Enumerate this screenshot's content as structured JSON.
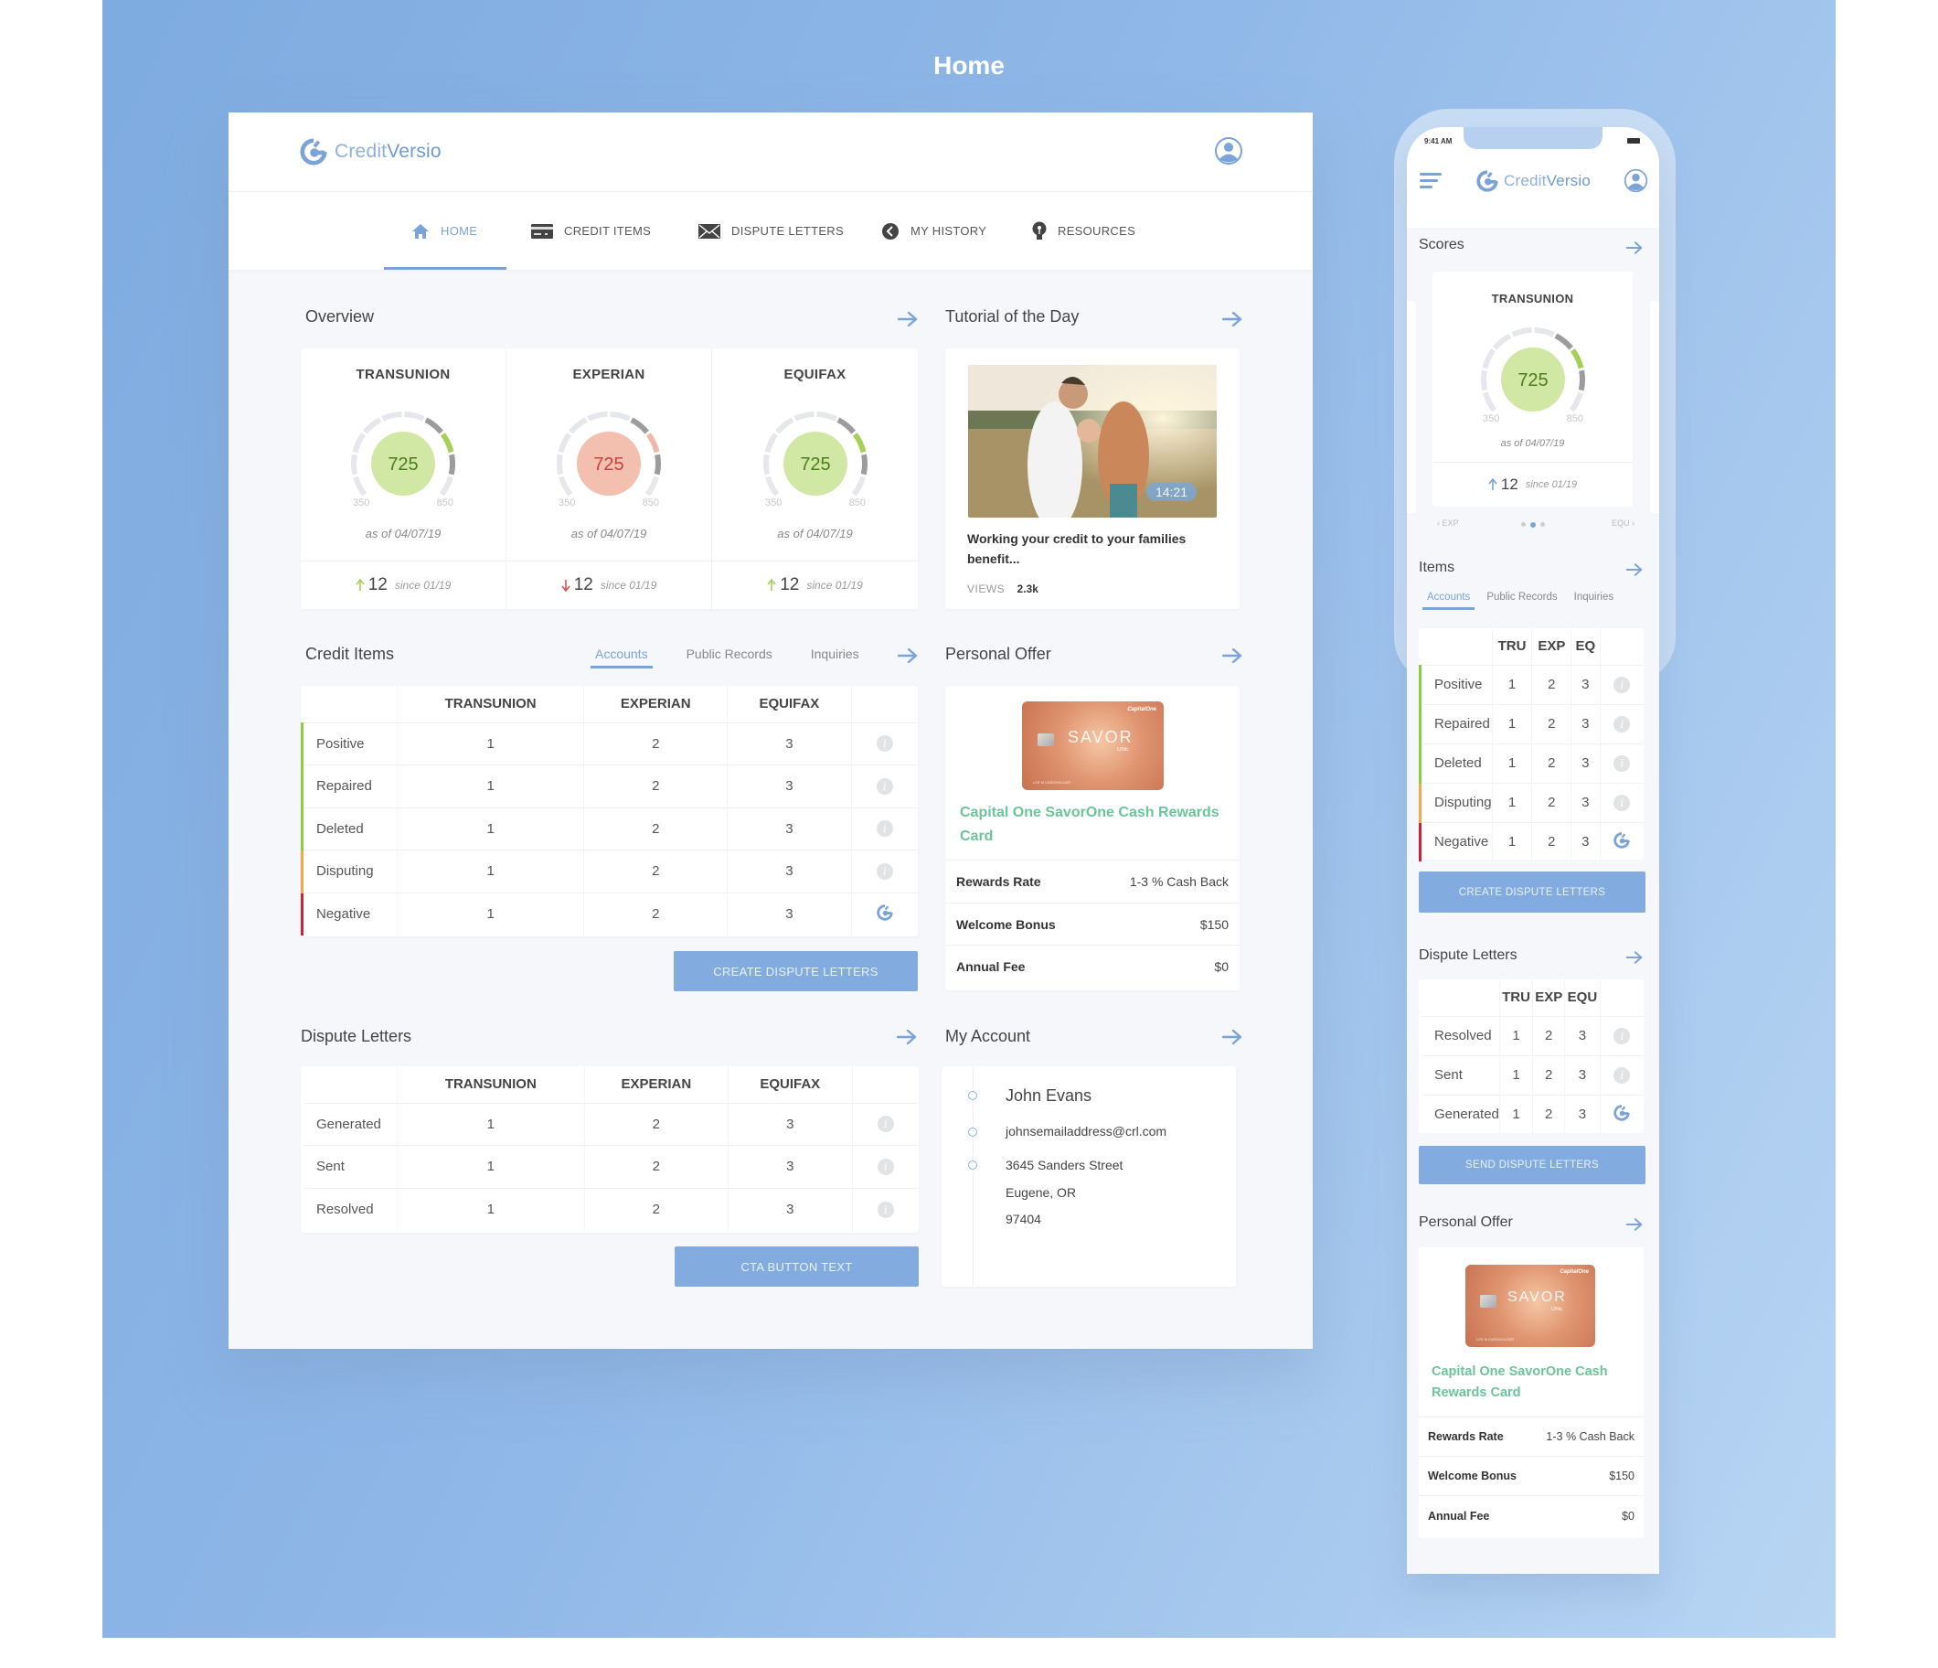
{
  "page_title": "Home",
  "brand": {
    "name_light": "Credit",
    "name_bold": "Versio"
  },
  "colors": {
    "accent": "#7aa3d8",
    "good": "#8fcb3f",
    "bad": "#e07b6c",
    "offer_green": "#6cc49a",
    "positive_bar": "#8fcb3f",
    "disputing_bar": "#f0a94a",
    "negative_bar": "#c7233a"
  },
  "nav": [
    {
      "label": "HOME",
      "icon": "home-icon",
      "active": true
    },
    {
      "label": "CREDIT ITEMS",
      "icon": "credit-card-icon"
    },
    {
      "label": "DISPUTE LETTERS",
      "icon": "envelope-icon"
    },
    {
      "label": "MY HISTORY",
      "icon": "history-icon"
    },
    {
      "label": "RESOURCES",
      "icon": "lightbulb-icon"
    }
  ],
  "overview": {
    "title": "Overview",
    "bureaus": [
      {
        "name": "TRANSUNION",
        "score": "725",
        "min": "350",
        "max": "850",
        "as_of": "as of 04/07/19",
        "delta": "12",
        "direction": "up",
        "since": "since 01/19",
        "tone": "good"
      },
      {
        "name": "EXPERIAN",
        "score": "725",
        "min": "350",
        "max": "850",
        "as_of": "as of 04/07/19",
        "delta": "12",
        "direction": "down",
        "since": "since 01/19",
        "tone": "bad"
      },
      {
        "name": "EQUIFAX",
        "score": "725",
        "min": "350",
        "max": "850",
        "as_of": "as of 04/07/19",
        "delta": "12",
        "direction": "up",
        "since": "since 01/19",
        "tone": "good"
      }
    ]
  },
  "tutorial": {
    "title": "Tutorial of the Day",
    "duration": "14:21",
    "caption": "Working your credit to your families benefit...",
    "views_label": "VIEWS",
    "views": "2.3k"
  },
  "credit_items": {
    "title": "Credit Items",
    "tabs": [
      "Accounts",
      "Public Records",
      "Inquiries"
    ],
    "active_tab": "Accounts",
    "columns": [
      "TRANSUNION",
      "EXPERIAN",
      "EQUIFAX"
    ],
    "rows": [
      {
        "label": "Positive",
        "values": [
          "1",
          "2",
          "3"
        ],
        "status": "positive",
        "action": "info"
      },
      {
        "label": "Repaired",
        "values": [
          "1",
          "2",
          "3"
        ],
        "status": "positive",
        "action": "info"
      },
      {
        "label": "Deleted",
        "values": [
          "1",
          "2",
          "3"
        ],
        "status": "positive",
        "action": "info"
      },
      {
        "label": "Disputing",
        "values": [
          "1",
          "2",
          "3"
        ],
        "status": "disputing",
        "action": "info"
      },
      {
        "label": "Negative",
        "values": [
          "1",
          "2",
          "3"
        ],
        "status": "negative",
        "action": "dispute"
      }
    ],
    "button": "CREATE DISPUTE LETTERS"
  },
  "dispute_letters": {
    "title": "Dispute Letters",
    "columns": [
      "TRANSUNION",
      "EXPERIAN",
      "EQUIFAX"
    ],
    "rows": [
      {
        "label": "Generated",
        "values": [
          "1",
          "2",
          "3"
        ]
      },
      {
        "label": "Sent",
        "values": [
          "1",
          "2",
          "3"
        ]
      },
      {
        "label": "Resolved",
        "values": [
          "1",
          "2",
          "3"
        ]
      }
    ],
    "button": "CTA BUTTON TEXT"
  },
  "offer": {
    "title": "Personal Offer",
    "card_name": "Capital One SavorOne Cash Rewards Card",
    "card_art": {
      "brand": "CapitalOne",
      "product": "SAVOR",
      "sub": "ONE",
      "holder": "LEE M CARDHOLDER"
    },
    "rows": [
      {
        "label": "Rewards Rate",
        "value": "1-3 % Cash Back"
      },
      {
        "label": "Welcome Bonus",
        "value": "$150"
      },
      {
        "label": "Annual Fee",
        "value": "$0"
      }
    ]
  },
  "account": {
    "title": "My Account",
    "name": "John Evans",
    "email": "johnsemailaddress@crl.com",
    "address": [
      "3645 Sanders Street",
      "Eugene, OR",
      "97404"
    ]
  },
  "mobile": {
    "status_time": "9:41 AM",
    "scores_title": "Scores",
    "score": {
      "name": "TRANSUNION",
      "score": "725",
      "min": "350",
      "max": "850",
      "as_of": "as of 04/07/19",
      "delta": "12",
      "since": "since 01/19"
    },
    "carousel": {
      "prev": "EXP",
      "next": "EQU",
      "pages": 3,
      "current": 2
    },
    "items_title": "Items",
    "items_tabs": [
      "Accounts",
      "Public Records",
      "Inquiries"
    ],
    "items_columns": [
      "TRU",
      "EXP",
      "EQ"
    ],
    "items_rows": [
      {
        "label": "Positive",
        "values": [
          "1",
          "2",
          "3"
        ],
        "status": "positive",
        "action": "info"
      },
      {
        "label": "Repaired",
        "values": [
          "1",
          "2",
          "3"
        ],
        "status": "positive",
        "action": "info"
      },
      {
        "label": "Deleted",
        "values": [
          "1",
          "2",
          "3"
        ],
        "status": "positive",
        "action": "info"
      },
      {
        "label": "Disputing",
        "values": [
          "1",
          "2",
          "3"
        ],
        "status": "disputing",
        "action": "info"
      },
      {
        "label": "Negative",
        "values": [
          "1",
          "2",
          "3"
        ],
        "status": "negative",
        "action": "dispute"
      }
    ],
    "items_button": "CREATE DISPUTE LETTERS",
    "letters_title": "Dispute Letters",
    "letters_columns": [
      "TRU",
      "EXP",
      "EQU"
    ],
    "letters_rows": [
      {
        "label": "Resolved",
        "values": [
          "1",
          "2",
          "3"
        ],
        "action": "info"
      },
      {
        "label": "Sent",
        "values": [
          "1",
          "2",
          "3"
        ],
        "action": "info"
      },
      {
        "label": "Generated",
        "values": [
          "1",
          "2",
          "3"
        ],
        "action": "dispute"
      }
    ],
    "letters_button": "SEND DISPUTE LETTERS",
    "offer_title": "Personal Offer",
    "offer_name": "Capital One SavorOne Cash Rewards Card",
    "offer_rows": [
      {
        "label": "Rewards Rate",
        "value": "1-3 % Cash Back"
      },
      {
        "label": "Welcome Bonus",
        "value": "$150"
      },
      {
        "label": "Annual Fee",
        "value": "$0"
      }
    ]
  }
}
